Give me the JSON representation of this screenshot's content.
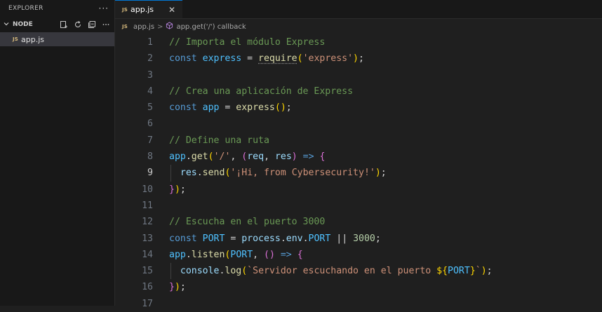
{
  "explorer": {
    "title": "EXPLORER",
    "more": "···",
    "folder": "NODE",
    "files": [
      {
        "badge": "JS",
        "name": "app.js"
      }
    ]
  },
  "tab": {
    "badge": "JS",
    "label": "app.js",
    "close": "✕"
  },
  "breadcrumb": {
    "badge": "JS",
    "file": "app.js",
    "sep": ">",
    "symbol": "app.get('/') callback"
  },
  "active_line": "9",
  "lines": [
    {
      "n": "1",
      "tokens": [
        {
          "t": "// Importa el módulo Express",
          "c": "c-com"
        }
      ]
    },
    {
      "n": "2",
      "tokens": [
        {
          "t": "const ",
          "c": "c-kw"
        },
        {
          "t": "express",
          "c": "c-const"
        },
        {
          "t": " = ",
          "c": "c-op"
        },
        {
          "t": "require",
          "c": "c-fn squig"
        },
        {
          "t": "(",
          "c": "c-b1"
        },
        {
          "t": "'express'",
          "c": "c-str"
        },
        {
          "t": ")",
          "c": "c-b1"
        },
        {
          "t": ";",
          "c": "c-op"
        }
      ]
    },
    {
      "n": "3",
      "tokens": []
    },
    {
      "n": "4",
      "tokens": [
        {
          "t": "// Crea una aplicación de Express",
          "c": "c-com"
        }
      ]
    },
    {
      "n": "5",
      "tokens": [
        {
          "t": "const ",
          "c": "c-kw"
        },
        {
          "t": "app",
          "c": "c-const"
        },
        {
          "t": " = ",
          "c": "c-op"
        },
        {
          "t": "express",
          "c": "c-fn"
        },
        {
          "t": "()",
          "c": "c-b1"
        },
        {
          "t": ";",
          "c": "c-op"
        }
      ]
    },
    {
      "n": "6",
      "tokens": []
    },
    {
      "n": "7",
      "tokens": [
        {
          "t": "// Define una ruta",
          "c": "c-com"
        }
      ]
    },
    {
      "n": "8",
      "tokens": [
        {
          "t": "app",
          "c": "c-const"
        },
        {
          "t": ".",
          "c": "c-op"
        },
        {
          "t": "get",
          "c": "c-fn"
        },
        {
          "t": "(",
          "c": "c-b1"
        },
        {
          "t": "'/'",
          "c": "c-str"
        },
        {
          "t": ", ",
          "c": "c-op"
        },
        {
          "t": "(",
          "c": "c-b2"
        },
        {
          "t": "req",
          "c": "c-var"
        },
        {
          "t": ", ",
          "c": "c-op"
        },
        {
          "t": "res",
          "c": "c-var"
        },
        {
          "t": ")",
          "c": "c-b2"
        },
        {
          "t": " => ",
          "c": "c-kw"
        },
        {
          "t": "{",
          "c": "c-b2"
        }
      ]
    },
    {
      "n": "9",
      "guide": true,
      "tokens": [
        {
          "t": "  ",
          "c": "c-op"
        },
        {
          "t": "res",
          "c": "c-var"
        },
        {
          "t": ".",
          "c": "c-op"
        },
        {
          "t": "send",
          "c": "c-fn"
        },
        {
          "t": "(",
          "c": "c-b1"
        },
        {
          "t": "'¡Hi, from Cybersecurity!'",
          "c": "c-str"
        },
        {
          "t": ")",
          "c": "c-b1"
        },
        {
          "t": ";",
          "c": "c-op"
        }
      ]
    },
    {
      "n": "10",
      "tokens": [
        {
          "t": "}",
          "c": "c-b2"
        },
        {
          "t": ")",
          "c": "c-b1"
        },
        {
          "t": ";",
          "c": "c-op"
        }
      ]
    },
    {
      "n": "11",
      "tokens": []
    },
    {
      "n": "12",
      "tokens": [
        {
          "t": "// Escucha en el puerto 3000",
          "c": "c-com"
        }
      ]
    },
    {
      "n": "13",
      "tokens": [
        {
          "t": "const ",
          "c": "c-kw"
        },
        {
          "t": "PORT",
          "c": "c-const"
        },
        {
          "t": " = ",
          "c": "c-op"
        },
        {
          "t": "process",
          "c": "c-var"
        },
        {
          "t": ".",
          "c": "c-op"
        },
        {
          "t": "env",
          "c": "c-var"
        },
        {
          "t": ".",
          "c": "c-op"
        },
        {
          "t": "PORT",
          "c": "c-const"
        },
        {
          "t": " || ",
          "c": "c-op"
        },
        {
          "t": "3000",
          "c": "c-num"
        },
        {
          "t": ";",
          "c": "c-op"
        }
      ]
    },
    {
      "n": "14",
      "tokens": [
        {
          "t": "app",
          "c": "c-const"
        },
        {
          "t": ".",
          "c": "c-op"
        },
        {
          "t": "listen",
          "c": "c-fn"
        },
        {
          "t": "(",
          "c": "c-b1"
        },
        {
          "t": "PORT",
          "c": "c-const"
        },
        {
          "t": ", ",
          "c": "c-op"
        },
        {
          "t": "()",
          "c": "c-b2"
        },
        {
          "t": " => ",
          "c": "c-kw"
        },
        {
          "t": "{",
          "c": "c-b2"
        }
      ]
    },
    {
      "n": "15",
      "guide": true,
      "tokens": [
        {
          "t": "  ",
          "c": "c-op"
        },
        {
          "t": "console",
          "c": "c-var"
        },
        {
          "t": ".",
          "c": "c-op"
        },
        {
          "t": "log",
          "c": "c-fn"
        },
        {
          "t": "(",
          "c": "c-b1"
        },
        {
          "t": "`Servidor escuchando en el puerto ",
          "c": "c-str"
        },
        {
          "t": "${",
          "c": "c-b1"
        },
        {
          "t": "PORT",
          "c": "c-const"
        },
        {
          "t": "}",
          "c": "c-b1"
        },
        {
          "t": "`",
          "c": "c-str"
        },
        {
          "t": ")",
          "c": "c-b1"
        },
        {
          "t": ";",
          "c": "c-op"
        }
      ]
    },
    {
      "n": "16",
      "tokens": [
        {
          "t": "}",
          "c": "c-b2"
        },
        {
          "t": ")",
          "c": "c-b1"
        },
        {
          "t": ";",
          "c": "c-op"
        }
      ]
    },
    {
      "n": "17",
      "tokens": []
    }
  ]
}
